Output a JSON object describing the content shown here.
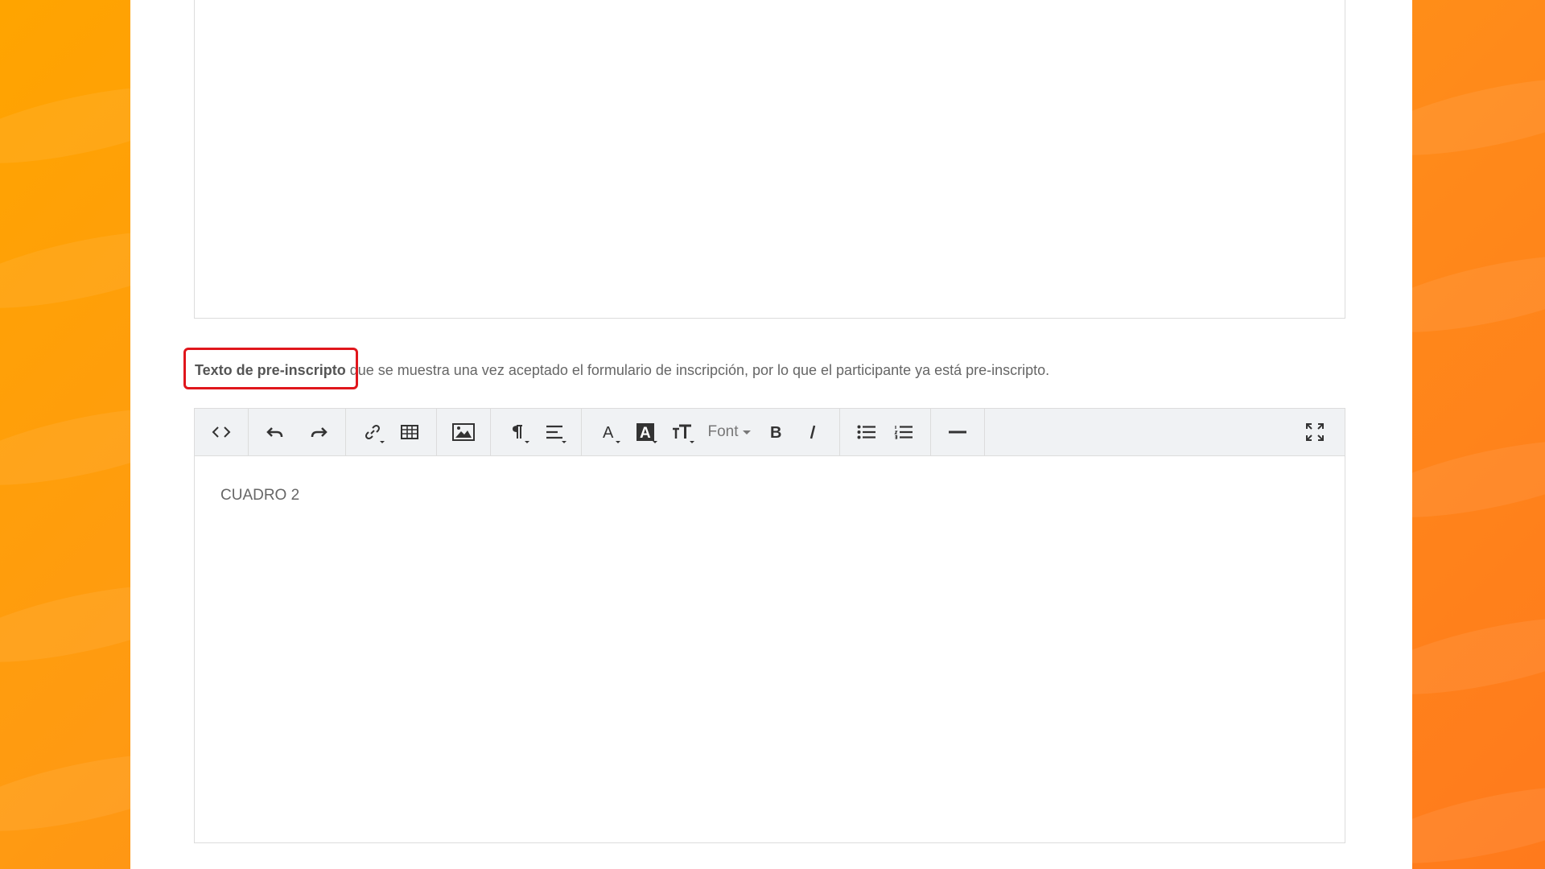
{
  "section": {
    "title": "Texto de pre-inscripto",
    "description": " que se muestra una vez aceptado el formulario de inscripción, por lo que el participante ya está pre-inscripto."
  },
  "toolbar": {
    "font_label": "Font",
    "buttons": [
      "code-view",
      "undo",
      "redo",
      "link",
      "table",
      "picture",
      "paragraph-style",
      "align",
      "font-color",
      "background-color",
      "font-size",
      "font",
      "bold",
      "italic",
      "unordered-list",
      "ordered-list",
      "horizontal-rule",
      "fullscreen"
    ]
  },
  "editor": {
    "content": "CUADRO 2"
  },
  "colors": {
    "background_orange": "#ff9a12",
    "highlight_red": "#e0161c",
    "toolbar_bg": "#f0f2f4"
  }
}
